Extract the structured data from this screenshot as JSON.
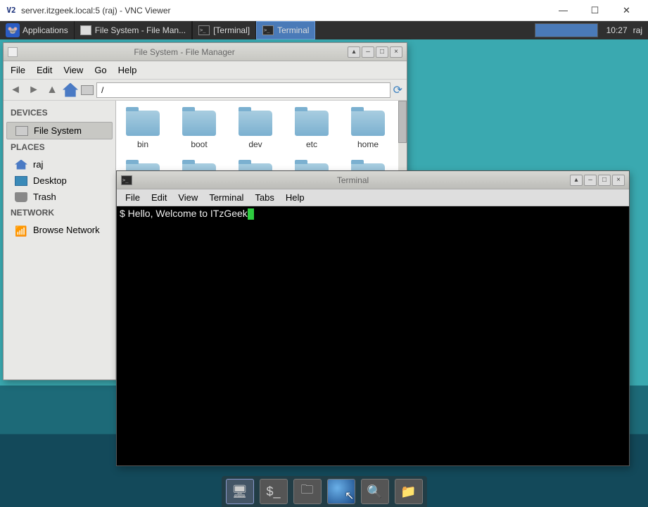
{
  "vnc": {
    "title": "server.itzgeek.local:5 (raj) - VNC Viewer",
    "app_abbrev": "V2"
  },
  "panel": {
    "apps_label": "Applications",
    "task_fm": "File System - File Man...",
    "task_term1": "[Terminal]",
    "task_term2": "Terminal",
    "clock": "10:27",
    "user": "raj"
  },
  "fm": {
    "title": "File System - File Manager",
    "menu": {
      "file": "File",
      "edit": "Edit",
      "view": "View",
      "go": "Go",
      "help": "Help"
    },
    "path": "/",
    "sidebar": {
      "devices": "DEVICES",
      "filesystem": "File System",
      "places": "PLACES",
      "home": "raj",
      "desktop": "Desktop",
      "trash": "Trash",
      "network": "NETWORK",
      "browse": "Browse Network"
    },
    "folders": [
      "bin",
      "boot",
      "dev",
      "etc",
      "home"
    ]
  },
  "term": {
    "title": "Terminal",
    "menu": {
      "file": "File",
      "edit": "Edit",
      "view": "View",
      "terminal": "Terminal",
      "tabs": "Tabs",
      "help": "Help"
    },
    "line": "$ Hello, Welcome to ITzGeek"
  }
}
